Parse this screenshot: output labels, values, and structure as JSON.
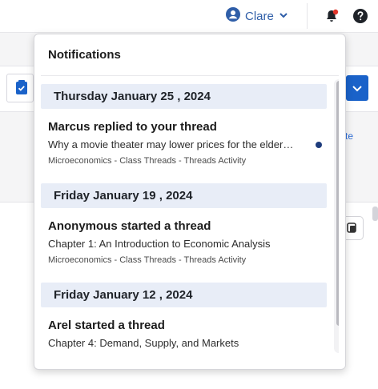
{
  "topbar": {
    "user_name": "Clare",
    "icons": [
      "user-icon",
      "chevron-down-icon",
      "bell-icon",
      "help-icon"
    ],
    "accent": "#2f5ea8",
    "notification_badge_color": "#e0352b"
  },
  "background": {
    "link_text": "te"
  },
  "notifications": {
    "title": "Notifications",
    "groups": [
      {
        "date": "Thursday January 25 , 2024",
        "items": [
          {
            "title": "Marcus replied to your thread",
            "subtitle": "Why a movie theater may lower prices for the elder…",
            "meta": "Microeconomics - Class Threads - Threads Activity",
            "unread": true
          }
        ]
      },
      {
        "date": "Friday January 19 , 2024",
        "items": [
          {
            "title": "Anonymous started a thread",
            "subtitle": "Chapter 1: An Introduction to Economic Analysis",
            "meta": "Microeconomics - Class Threads - Threads Activity",
            "unread": false
          }
        ]
      },
      {
        "date": "Friday January 12 , 2024",
        "items": [
          {
            "title": "Arel started a thread",
            "subtitle": "Chapter 4: Demand, Supply, and Markets",
            "unread": false
          }
        ]
      }
    ]
  }
}
